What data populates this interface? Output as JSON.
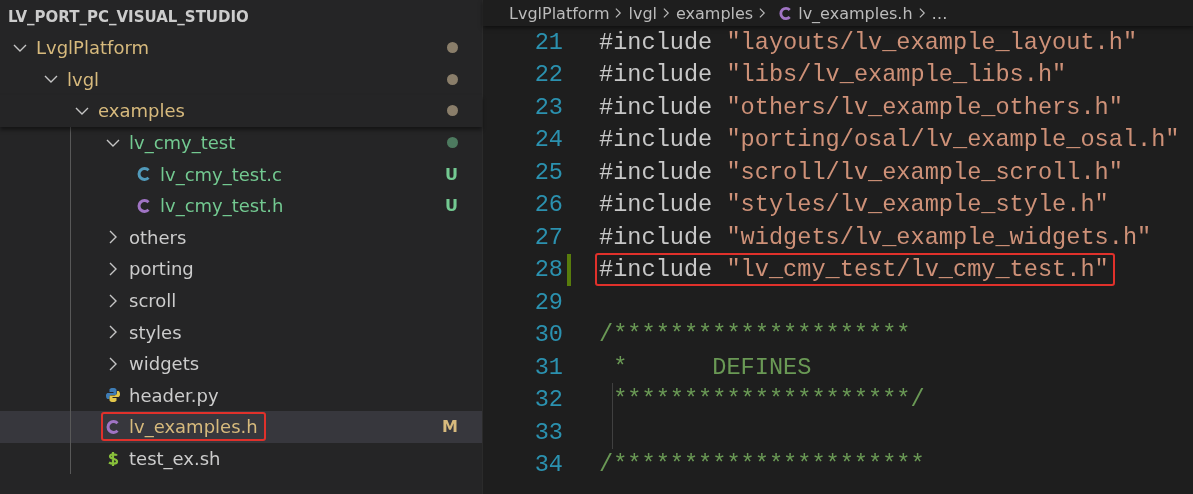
{
  "explorer": {
    "title": "LV_PORT_PC_VISUAL_STUDIO",
    "tree": [
      {
        "label": "LvglPlatform",
        "kind": "folder",
        "expanded": true,
        "color": "#d7ba7d",
        "dot": {
          "color": "#8a7e6a"
        },
        "children": [
          {
            "label": "lvgl",
            "kind": "folder",
            "expanded": true,
            "color": "#d7ba7d",
            "dot": {
              "color": "#8a7e6a"
            },
            "children": [
              {
                "label": "examples",
                "kind": "folder",
                "expanded": true,
                "color": "#d7ba7d",
                "dot": {
                  "color": "#8a7e6a"
                },
                "children": [
                  {
                    "label": "lv_cmy_test",
                    "kind": "folder",
                    "expanded": true,
                    "color": "#73c991",
                    "dot": {
                      "color": "#4d7a5f"
                    },
                    "children": [
                      {
                        "label": "lv_cmy_test.c",
                        "kind": "c",
                        "color": "#73c991",
                        "decoration": "U",
                        "selected": false,
                        "highlighted": false
                      },
                      {
                        "label": "lv_cmy_test.h",
                        "kind": "h",
                        "color": "#73c991",
                        "decoration": "U",
                        "selected": false,
                        "highlighted": false
                      }
                    ]
                  },
                  {
                    "label": "others",
                    "kind": "folder",
                    "expanded": false
                  },
                  {
                    "label": "porting",
                    "kind": "folder",
                    "expanded": false
                  },
                  {
                    "label": "scroll",
                    "kind": "folder",
                    "expanded": false
                  },
                  {
                    "label": "styles",
                    "kind": "folder",
                    "expanded": false
                  },
                  {
                    "label": "widgets",
                    "kind": "folder",
                    "expanded": false
                  },
                  {
                    "label": "header.py",
                    "kind": "python",
                    "selected": false,
                    "highlighted": false
                  },
                  {
                    "label": "lv_examples.h",
                    "kind": "h",
                    "color": "#d7ba7d",
                    "decoration": "M",
                    "selected": true,
                    "highlighted": true
                  },
                  {
                    "label": "test_ex.sh",
                    "kind": "shell",
                    "selected": false,
                    "highlighted": false
                  }
                ]
              }
            ]
          }
        ]
      }
    ]
  },
  "breadcrumb": [
    {
      "label": "LvglPlatform",
      "kind": "folder"
    },
    {
      "label": "lvgl",
      "kind": "folder"
    },
    {
      "label": "examples",
      "kind": "folder"
    },
    {
      "label": "lv_examples.h",
      "kind": "h"
    },
    {
      "label": "…",
      "kind": "more"
    }
  ],
  "editor": {
    "lines": [
      {
        "number": "21",
        "kind": "include",
        "directive": "#include",
        "path": "\"layouts/lv_example_layout.h\"",
        "changed": false,
        "highlighted": false
      },
      {
        "number": "22",
        "kind": "include",
        "directive": "#include",
        "path": "\"libs/lv_example_libs.h\"",
        "changed": false,
        "highlighted": false
      },
      {
        "number": "23",
        "kind": "include",
        "directive": "#include",
        "path": "\"others/lv_example_others.h\"",
        "changed": false,
        "highlighted": false
      },
      {
        "number": "24",
        "kind": "include",
        "directive": "#include",
        "path": "\"porting/osal/lv_example_osal.h\"",
        "changed": false,
        "highlighted": false
      },
      {
        "number": "25",
        "kind": "include",
        "directive": "#include",
        "path": "\"scroll/lv_example_scroll.h\"",
        "changed": false,
        "highlighted": false
      },
      {
        "number": "26",
        "kind": "include",
        "directive": "#include",
        "path": "\"styles/lv_example_style.h\"",
        "changed": false,
        "highlighted": false
      },
      {
        "number": "27",
        "kind": "include",
        "directive": "#include",
        "path": "\"widgets/lv_example_widgets.h\"",
        "changed": false,
        "highlighted": false
      },
      {
        "number": "28",
        "kind": "include",
        "directive": "#include",
        "path": "\"lv_cmy_test/lv_cmy_test.h\"",
        "changed": true,
        "highlighted": true
      },
      {
        "number": "29",
        "kind": "blank",
        "changed": false,
        "highlighted": false
      },
      {
        "number": "30",
        "kind": "comment",
        "text": "/*********************",
        "changed": false,
        "highlighted": false
      },
      {
        "number": "31",
        "kind": "comment",
        "text": " *      DEFINES",
        "changed": false,
        "highlighted": false
      },
      {
        "number": "32",
        "kind": "comment",
        "text": " *********************/",
        "changed": false,
        "highlighted": false
      },
      {
        "number": "33",
        "kind": "blank",
        "changed": false,
        "highlighted": false
      },
      {
        "number": "34",
        "kind": "comment",
        "text": "/**********************",
        "changed": false,
        "highlighted": false
      }
    ]
  }
}
